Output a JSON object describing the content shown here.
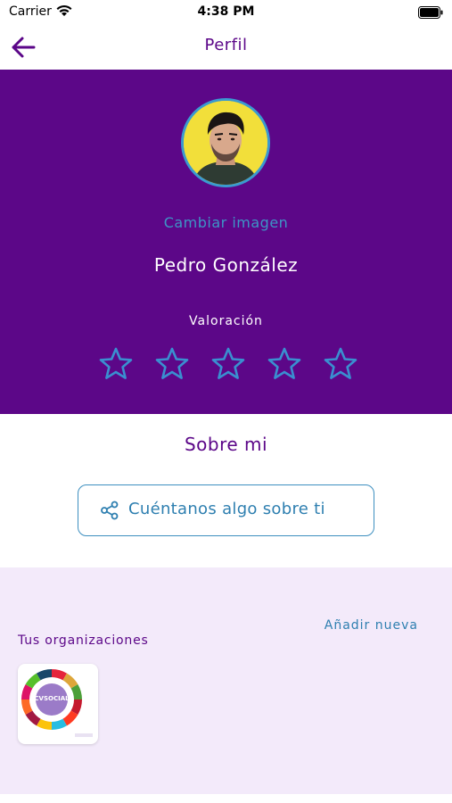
{
  "status_bar": {
    "carrier": "Carrier",
    "time": "4:38 PM"
  },
  "header": {
    "title": "Perfil"
  },
  "profile": {
    "change_image": "Cambiar imagen",
    "name": "Pedro González",
    "rating_label": "Valoración",
    "rating_value": 0,
    "rating_max": 5,
    "colors": {
      "background": "#5c0788",
      "accent": "#3d95c6"
    }
  },
  "about": {
    "title": "Sobre mi",
    "button_label": "Cuéntanos algo sobre ti",
    "button_icon": "share-icon"
  },
  "organizations": {
    "add_label": "Añadir nueva",
    "section_label": "Tus organizaciones",
    "items": [
      {
        "logo_text": "CVSOCIAL"
      }
    ]
  }
}
